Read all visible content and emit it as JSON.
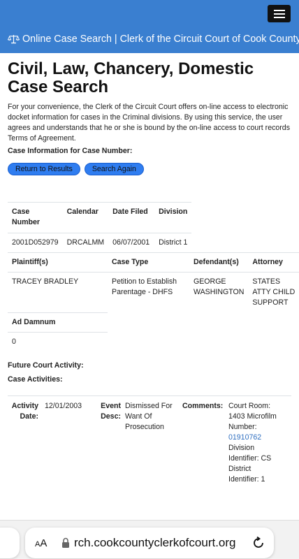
{
  "header": {
    "site_title": "Online Case Search | Clerk of the Circuit Court of Cook County",
    "menu_icon": "hamburger-menu-icon",
    "brand_icon": "scales-of-justice-icon",
    "brand_color": "#3a7fd0"
  },
  "page": {
    "title": "Civil, Law, Chancery, Domestic Case Search",
    "intro": "For your convenience, the Clerk of the Circuit Court offers on-line access to electronic docket information for cases in the Criminal divisions. By using this service, the user agrees and understands that he or she is bound by the on-line access to court records Terms of Agreement.",
    "case_info_label": "Case Information for Case Number:",
    "buttons": {
      "return": "Return to Results",
      "search_again": "Search Again"
    }
  },
  "case_table": {
    "headers": [
      "Case Number",
      "Calendar",
      "Date Filed",
      "Division"
    ],
    "row": [
      "2001D052979",
      "DRCALMM",
      "06/07/2001",
      "District 1"
    ]
  },
  "parties_table": {
    "headers": [
      "Plaintiff(s)",
      "Case Type",
      "Defendant(s)",
      "Attorney"
    ],
    "row": [
      "TRACEY BRADLEY",
      "Petition to Establish Parentage - DHFS",
      "GEORGE WASHINGTON",
      "STATES ATTY CHILD SUPPORT"
    ]
  },
  "damnum_table": {
    "header": "Ad Damnum",
    "value": "0"
  },
  "future_label": "Future Court Activity:",
  "activities_label": "Case Activities:",
  "activity": {
    "date_label": "Activity Date:",
    "date": "12/01/2003",
    "desc_label": "Event Desc:",
    "desc": "Dismissed For Want Of Prosecution",
    "comments_label": "Comments:",
    "comments_pre": "Court Room: 1403 Microfilm Number:",
    "microfilm_link": "01910762",
    "comments_post": "Division Identifier: CS District Identifier: 1"
  },
  "browser": {
    "aa_label": "AA",
    "url": "rch.cookcountyclerkofcourt.org",
    "lock_icon": "lock-icon",
    "reload_icon": "reload-icon"
  }
}
